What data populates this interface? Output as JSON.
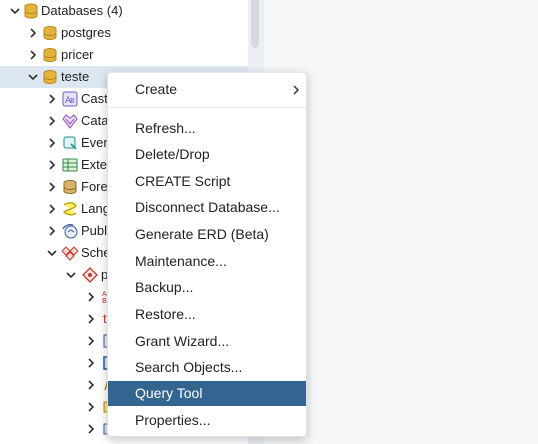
{
  "tree": {
    "databases_label": "Databases (4)",
    "db_postgres": "postgres",
    "db_pricer": "pricer",
    "db_teste": "teste",
    "children": {
      "casts": "Cast",
      "catalogs": "Cata",
      "event_triggers": "Ever",
      "extensions": "Exte",
      "foreign_data_wrappers": "Fore",
      "languages": "Lang",
      "publications": "Publ",
      "schemas": "Sche",
      "public_schema": "p",
      "schema_child_1": "",
      "schema_child_2": "t"
    }
  },
  "context_menu": {
    "create": "Create",
    "refresh": "Refresh...",
    "delete_drop": "Delete/Drop",
    "create_script": "CREATE Script",
    "disconnect": "Disconnect Database...",
    "generate_erd": "Generate ERD (Beta)",
    "maintenance": "Maintenance...",
    "backup": "Backup...",
    "restore": "Restore...",
    "grant_wizard": "Grant Wizard...",
    "search_objects": "Search Objects...",
    "query_tool": "Query Tool",
    "properties": "Properties..."
  },
  "colors": {
    "menu_highlight": "#326690",
    "selected_row": "#dde7f2",
    "database_icon": "#d9a520"
  },
  "icons": {
    "expand": "chevron-right-icon",
    "collapse": "chevron-down-icon",
    "database": "database-icon",
    "submenu": "submenu-arrow-icon"
  }
}
